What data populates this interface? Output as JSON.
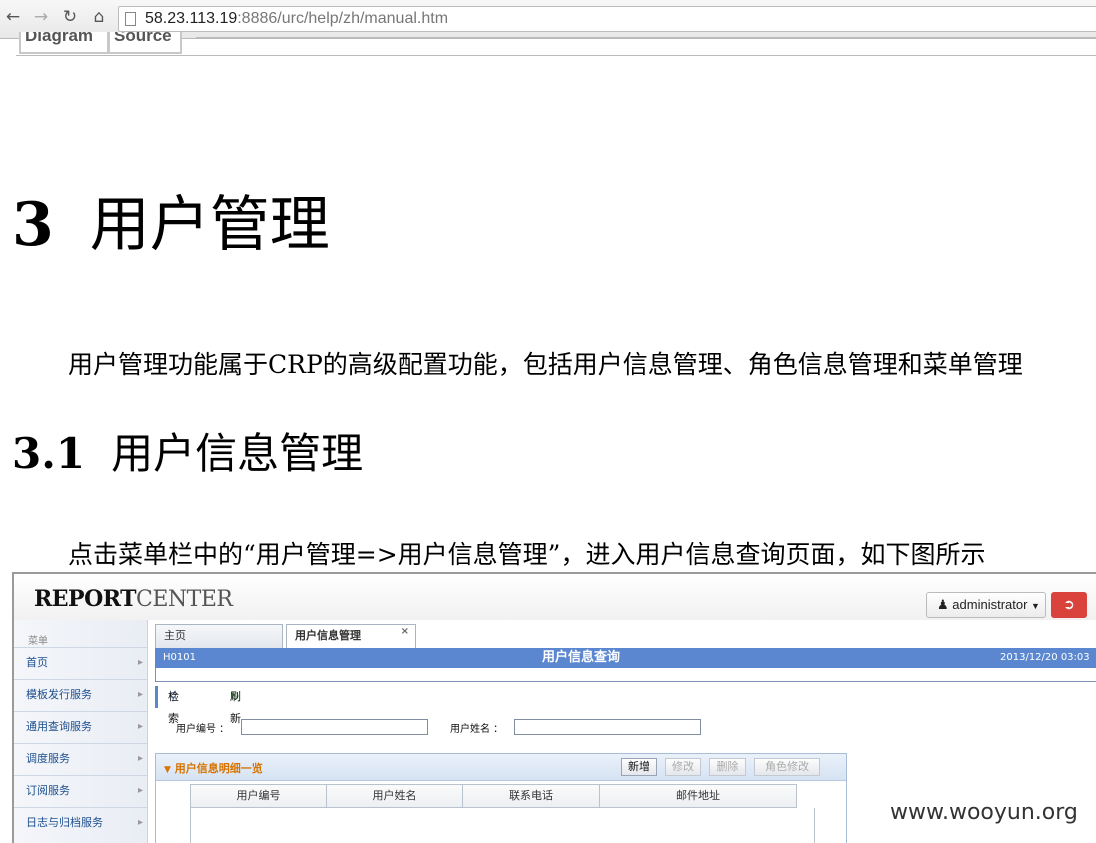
{
  "browser": {
    "url_host": "58.23.113.19",
    "url_rest": ":8886/urc/help/zh/manual.htm",
    "icons": [
      "back-arrow-icon",
      "forward-arrow-icon",
      "reload-icon",
      "home-icon",
      "page-icon"
    ]
  },
  "doc_tabs": [
    "Diagram",
    "Source"
  ],
  "heading1": {
    "num": "3",
    "text": "用户管理"
  },
  "intro": "用户管理功能属于CRP的高级配置功能，包括用户信息管理、角色信息管理和菜单管理",
  "heading2": {
    "num": "3.1",
    "text": "用户信息管理"
  },
  "instruction": "点击菜单栏中的“用户管理=>用户信息管理”，进入用户信息查询页面，如下图所示",
  "app": {
    "logo_bold": "REPORT",
    "logo_light": "CENTER",
    "user": "administrator",
    "menu_label": "菜单",
    "sidebar": [
      "首页",
      "模板发行服务",
      "通用查询服务",
      "调度服务",
      "订阅服务",
      "日志与归档服务"
    ],
    "tabs": [
      {
        "label": "主页"
      },
      {
        "label": "用户信息管理",
        "close": "×"
      }
    ],
    "titlebar": {
      "code": "H0101",
      "title": "用户信息查询",
      "date": "2013/12/20 03:03"
    },
    "actions": {
      "search": "检索",
      "refresh": "刷新"
    },
    "form": {
      "user_id_label": "用户编号 ：",
      "user_name_label": "用户姓名 ：",
      "user_id_value": "",
      "user_name_value": ""
    },
    "grid": {
      "title": "用户信息明细一览",
      "buttons": {
        "add": "新增",
        "edit": "修改",
        "delete": "删除",
        "role_edit": "角色修改"
      },
      "columns": [
        "用户编号",
        "用户姓名",
        "联系电话",
        "邮件地址"
      ]
    }
  },
  "watermark": "www.wooyun.org",
  "colors": {
    "title_bar": "#5b87d0",
    "exit_button": "#d9433b",
    "grid_title": "#d87400",
    "menu_text": "#1d4f8e"
  }
}
